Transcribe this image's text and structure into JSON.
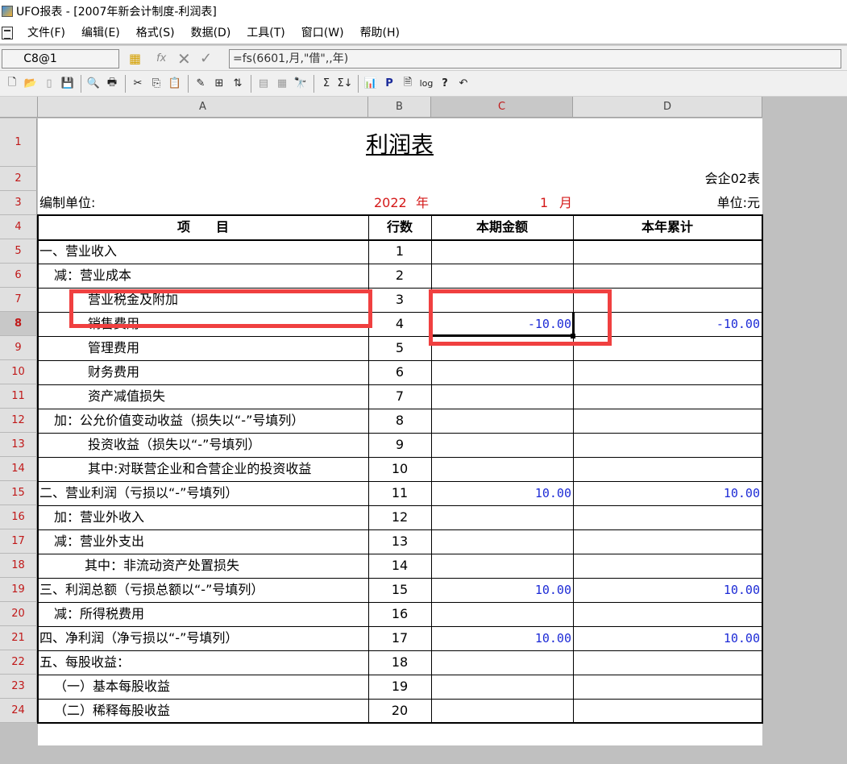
{
  "window": {
    "title": "UFO报表 - [2007年新会计制度-利润表]"
  },
  "menu": [
    "文件(F)",
    "编辑(E)",
    "格式(S)",
    "数据(D)",
    "工具(T)",
    "窗口(W)",
    "帮助(H)"
  ],
  "formula_bar": {
    "cell_ref": "C8@1",
    "formula": "=fs(6601,月,\"借\",,年)"
  },
  "columns": [
    "A",
    "B",
    "C",
    "D"
  ],
  "active_column": "C",
  "active_row": 8,
  "report": {
    "title": "利润表",
    "form_no": "会企02表",
    "unit_label": "编制单位:",
    "year": "2022",
    "year_label": "年",
    "month": "1",
    "month_label": "月",
    "currency": "单位:元",
    "headers": {
      "item": "项　　目",
      "line_no": "行数",
      "current": "本期金额",
      "ytd": "本年累计"
    }
  },
  "rows": [
    {
      "r": 5,
      "item": "一、营业收入",
      "indent": 0,
      "no": "1",
      "cur": "",
      "ytd": ""
    },
    {
      "r": 6,
      "item": "减：营业成本",
      "indent": 1,
      "no": "2",
      "cur": "",
      "ytd": ""
    },
    {
      "r": 7,
      "item": "营业税金及附加",
      "indent": 2,
      "no": "3",
      "cur": "",
      "ytd": ""
    },
    {
      "r": 8,
      "item": "销售费用",
      "indent": 2,
      "no": "4",
      "cur": "-10.00",
      "ytd": "-10.00"
    },
    {
      "r": 9,
      "item": "管理费用",
      "indent": 2,
      "no": "5",
      "cur": "",
      "ytd": ""
    },
    {
      "r": 10,
      "item": "财务费用",
      "indent": 2,
      "no": "6",
      "cur": "",
      "ytd": ""
    },
    {
      "r": 11,
      "item": "资产减值损失",
      "indent": 2,
      "no": "7",
      "cur": "",
      "ytd": ""
    },
    {
      "r": 12,
      "item": "加：公允价值变动收益（损失以“-”号填列）",
      "indent": 1,
      "no": "8",
      "cur": "",
      "ytd": ""
    },
    {
      "r": 13,
      "item": "投资收益（损失以“-”号填列）",
      "indent": 2,
      "no": "9",
      "cur": "",
      "ytd": ""
    },
    {
      "r": 14,
      "item": "其中:对联营企业和合营企业的投资收益",
      "indent": 2,
      "no": "10",
      "cur": "",
      "ytd": ""
    },
    {
      "r": 15,
      "item": "二、营业利润（亏损以“-”号填列）",
      "indent": 0,
      "no": "11",
      "cur": "10.00",
      "ytd": "10.00"
    },
    {
      "r": 16,
      "item": "加：营业外收入",
      "indent": 1,
      "no": "12",
      "cur": "",
      "ytd": ""
    },
    {
      "r": 17,
      "item": "减：营业外支出",
      "indent": 1,
      "no": "13",
      "cur": "",
      "ytd": ""
    },
    {
      "r": 18,
      "item": "其中：非流动资产处置损失",
      "indent": 3,
      "no": "14",
      "cur": "",
      "ytd": ""
    },
    {
      "r": 19,
      "item": "三、利润总额（亏损总额以“-”号填列）",
      "indent": 0,
      "no": "15",
      "cur": "10.00",
      "ytd": "10.00"
    },
    {
      "r": 20,
      "item": "减：所得税费用",
      "indent": 1,
      "no": "16",
      "cur": "",
      "ytd": ""
    },
    {
      "r": 21,
      "item": "四、净利润（净亏损以“-”号填列）",
      "indent": 0,
      "no": "17",
      "cur": "10.00",
      "ytd": "10.00"
    },
    {
      "r": 22,
      "item": "五、每股收益：",
      "indent": 0,
      "no": "18",
      "cur": "",
      "ytd": ""
    },
    {
      "r": 23,
      "item": "（一）基本每股收益",
      "indent": 1,
      "no": "19",
      "cur": "",
      "ytd": ""
    },
    {
      "r": 24,
      "item": "（二）稀释每股收益",
      "indent": 1,
      "no": "20",
      "cur": "",
      "ytd": ""
    }
  ],
  "icons": [
    "new-icon",
    "open-icon",
    "blank-page-icon",
    "save-icon",
    "print-preview-icon",
    "print-icon",
    "cut-icon",
    "copy-icon",
    "paste-icon",
    "format-painter-icon",
    "insert-icon",
    "sort-icon",
    "merge-icon",
    "split-icon",
    "find-icon",
    "sum-icon",
    "sum-row-icon",
    "chart-icon",
    "property-icon",
    "page-icon",
    "log-icon",
    "help-icon",
    "undo-icon"
  ],
  "colors": {
    "highlight": "#f04040",
    "value_blue": "#1d2bd6",
    "row_header_red": "#c01818",
    "date_red": "#d41818"
  }
}
